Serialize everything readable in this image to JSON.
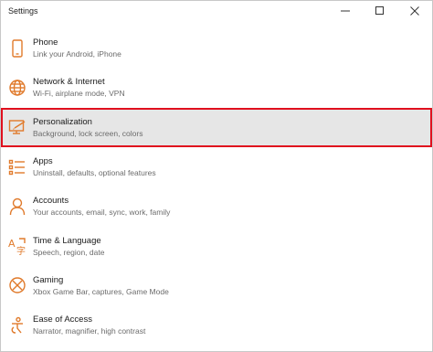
{
  "window": {
    "title": "Settings",
    "accent_color": "#e07a2b",
    "highlight_color": "#e0101e"
  },
  "controls": {
    "minimize_icon": "minimize-icon",
    "maximize_icon": "maximize-icon",
    "close_icon": "close-icon"
  },
  "items": [
    {
      "label": "Phone",
      "desc": "Link your Android, iPhone",
      "icon": "phone-icon"
    },
    {
      "label": "Network & Internet",
      "desc": "Wi-Fi, airplane mode, VPN",
      "icon": "globe-icon"
    },
    {
      "label": "Personalization",
      "desc": "Background, lock screen, colors",
      "icon": "personalization-icon",
      "selected": true
    },
    {
      "label": "Apps",
      "desc": "Uninstall, defaults, optional features",
      "icon": "apps-list-icon"
    },
    {
      "label": "Accounts",
      "desc": "Your accounts, email, sync, work, family",
      "icon": "person-icon"
    },
    {
      "label": "Time & Language",
      "desc": "Speech, region, date",
      "icon": "time-language-icon"
    },
    {
      "label": "Gaming",
      "desc": "Xbox Game Bar, captures, Game Mode",
      "icon": "xbox-icon"
    },
    {
      "label": "Ease of Access",
      "desc": "Narrator, magnifier, high contrast",
      "icon": "ease-of-access-icon"
    }
  ]
}
